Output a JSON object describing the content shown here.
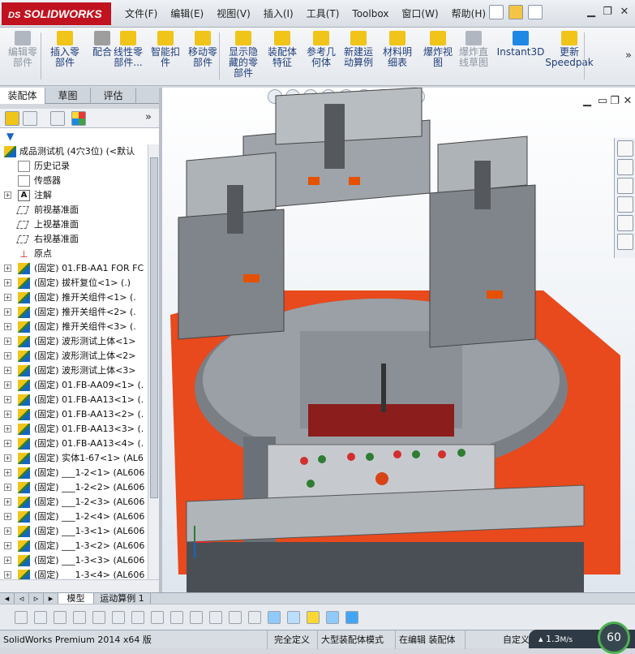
{
  "app": {
    "logo_ds": "DS",
    "logo_text": "SOLIDWORKS"
  },
  "menus": [
    "文件(F)",
    "编辑(E)",
    "视图(V)",
    "插入(I)",
    "工具(T)",
    "Toolbox",
    "窗口(W)",
    "帮助(H)"
  ],
  "commands": [
    {
      "label": "编辑零\n部件",
      "enabled": false,
      "icon": "edit-component-icon"
    },
    {
      "label": "插入零\n部件",
      "enabled": true,
      "icon": "insert-component-icon"
    },
    {
      "label": "配合",
      "enabled": true,
      "icon": "mate-icon"
    },
    {
      "label": "线性零\n部件...",
      "enabled": true,
      "icon": "linear-pattern-icon"
    },
    {
      "label": "智能扣\n件",
      "enabled": true,
      "icon": "smart-fastener-icon"
    },
    {
      "label": "移动零\n部件",
      "enabled": true,
      "icon": "move-component-icon"
    },
    {
      "label": "显示隐\n藏的零\n部件",
      "enabled": true,
      "icon": "show-hidden-icon"
    },
    {
      "label": "装配体\n特征",
      "enabled": true,
      "icon": "assembly-feature-icon"
    },
    {
      "label": "参考几\n何体",
      "enabled": true,
      "icon": "reference-geometry-icon"
    },
    {
      "label": "新建运\n动算例",
      "enabled": true,
      "icon": "motion-study-icon"
    },
    {
      "label": "材料明\n细表",
      "enabled": true,
      "icon": "bom-icon"
    },
    {
      "label": "爆炸视\n图",
      "enabled": true,
      "icon": "exploded-view-icon"
    },
    {
      "label": "爆炸直\n线草图",
      "enabled": false,
      "icon": "explode-line-icon"
    },
    {
      "label": "Instant3D",
      "enabled": true,
      "icon": "instant3d-icon"
    },
    {
      "label": "更新\nSpeedpak",
      "enabled": true,
      "icon": "speedpak-icon"
    }
  ],
  "left_tabs": [
    "装配体",
    "草图",
    "评估"
  ],
  "tree": {
    "root": "成品测试机 (4穴3位)  (<默认",
    "items": [
      {
        "label": "历史记录",
        "icon": "folder",
        "expand": ""
      },
      {
        "label": "传感器",
        "icon": "folder",
        "expand": ""
      },
      {
        "label": "注解",
        "icon": "ann",
        "expand": "+"
      },
      {
        "label": "前视基准面",
        "icon": "plane",
        "expand": ""
      },
      {
        "label": "上视基准面",
        "icon": "plane",
        "expand": ""
      },
      {
        "label": "右视基准面",
        "icon": "plane",
        "expand": ""
      },
      {
        "label": "原点",
        "icon": "orig",
        "expand": ""
      },
      {
        "label": "(固定) 01.FB-AA1 FOR FC",
        "icon": "asm",
        "expand": "+"
      },
      {
        "label": "(固定) 拔杆复位<1> (.)",
        "icon": "asm",
        "expand": "+"
      },
      {
        "label": "(固定) 推开关组件<1> (.",
        "icon": "asm",
        "expand": "+"
      },
      {
        "label": "(固定) 推开关组件<2> (.",
        "icon": "asm",
        "expand": "+"
      },
      {
        "label": "(固定) 推开关组件<3> (.",
        "icon": "asm",
        "expand": "+"
      },
      {
        "label": "(固定) 波形测试上体<1>",
        "icon": "asm",
        "expand": "+"
      },
      {
        "label": "(固定) 波形测试上体<2>",
        "icon": "asm",
        "expand": "+"
      },
      {
        "label": "(固定) 波形测试上体<3>",
        "icon": "asm",
        "expand": "+"
      },
      {
        "label": "(固定) 01.FB-AA09<1> (.",
        "icon": "asm",
        "expand": "+"
      },
      {
        "label": "(固定) 01.FB-AA13<1> (.",
        "icon": "asm",
        "expand": "+"
      },
      {
        "label": "(固定) 01.FB-AA13<2> (.",
        "icon": "asm",
        "expand": "+"
      },
      {
        "label": "(固定) 01.FB-AA13<3> (.",
        "icon": "asm",
        "expand": "+"
      },
      {
        "label": "(固定) 01.FB-AA13<4> (.",
        "icon": "asm",
        "expand": "+"
      },
      {
        "label": "(固定) 实体1-67<1> (AL6",
        "icon": "asm",
        "expand": "+"
      },
      {
        "label": "(固定) ___1-2<1> (AL606",
        "icon": "asm",
        "expand": "+"
      },
      {
        "label": "(固定) ___1-2<2> (AL606",
        "icon": "asm",
        "expand": "+"
      },
      {
        "label": "(固定) ___1-2<3> (AL606",
        "icon": "asm",
        "expand": "+"
      },
      {
        "label": "(固定) ___1-2<4> (AL606",
        "icon": "asm",
        "expand": "+"
      },
      {
        "label": "(固定) ___1-3<1> (AL606",
        "icon": "asm",
        "expand": "+"
      },
      {
        "label": "(固定) ___1-3<2> (AL606",
        "icon": "asm",
        "expand": "+"
      },
      {
        "label": "(固定) ___1-3<3> (AL606",
        "icon": "asm",
        "expand": "+"
      },
      {
        "label": "(固定) ___1-3<4> (AL606",
        "icon": "asm",
        "expand": "+"
      }
    ]
  },
  "bottom_tabs": [
    "模型",
    "运动算例 1"
  ],
  "status": {
    "product": "SolidWorks Premium 2014 x64 版",
    "defined": "完全定义",
    "mode": "大型装配体模式",
    "editing": "在编辑 装配体",
    "custom": "自定义",
    "speed": "1.3",
    "speed_unit": "M/s",
    "perf": "60"
  },
  "colors": {
    "brand": "#c1121f",
    "machine_base": "#e8491d",
    "steel": "#8d9399",
    "panel_red": "#8b1d1d"
  }
}
